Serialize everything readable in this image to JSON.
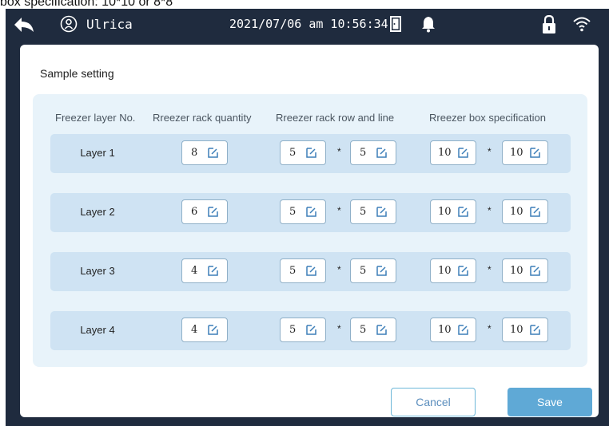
{
  "caption": "box specification: 10*10 or 8*8",
  "status_bar": {
    "user_name": "Ulrica",
    "datetime": "2021/07/06 am 10:56:34"
  },
  "dialog": {
    "title": "Sample setting",
    "columns": [
      "Freezer layer No.",
      "Rreezer rack quantity",
      "Rreezer rack row and line",
      "Rreezer box specification"
    ],
    "rows": [
      {
        "layer": "Layer 1",
        "rack_quantity": "8",
        "rack_row": "5",
        "rack_line": "5",
        "box_a": "10",
        "box_b": "10"
      },
      {
        "layer": "Layer 2",
        "rack_quantity": "6",
        "rack_row": "5",
        "rack_line": "5",
        "box_a": "10",
        "box_b": "10"
      },
      {
        "layer": "Layer 3",
        "rack_quantity": "4",
        "rack_row": "5",
        "rack_line": "5",
        "box_a": "10",
        "box_b": "10"
      },
      {
        "layer": "Layer 4",
        "rack_quantity": "4",
        "rack_row": "5",
        "rack_line": "5",
        "box_a": "10",
        "box_b": "10"
      }
    ],
    "separator": "*",
    "cancel_label": "Cancel",
    "save_label": "Save"
  },
  "icons": {
    "back": "back-arrow-icon",
    "user": "user-circle-icon",
    "door": "door-icon",
    "bell": "bell-icon",
    "lock": "lock-icon",
    "wifi": "wifi-icon",
    "edit": "edit-icon"
  },
  "colors": {
    "status_bar": "#1f2b3e",
    "panel": "#e8f3fa",
    "row": "#cfe3f3",
    "accent": "#5fa9d6"
  }
}
